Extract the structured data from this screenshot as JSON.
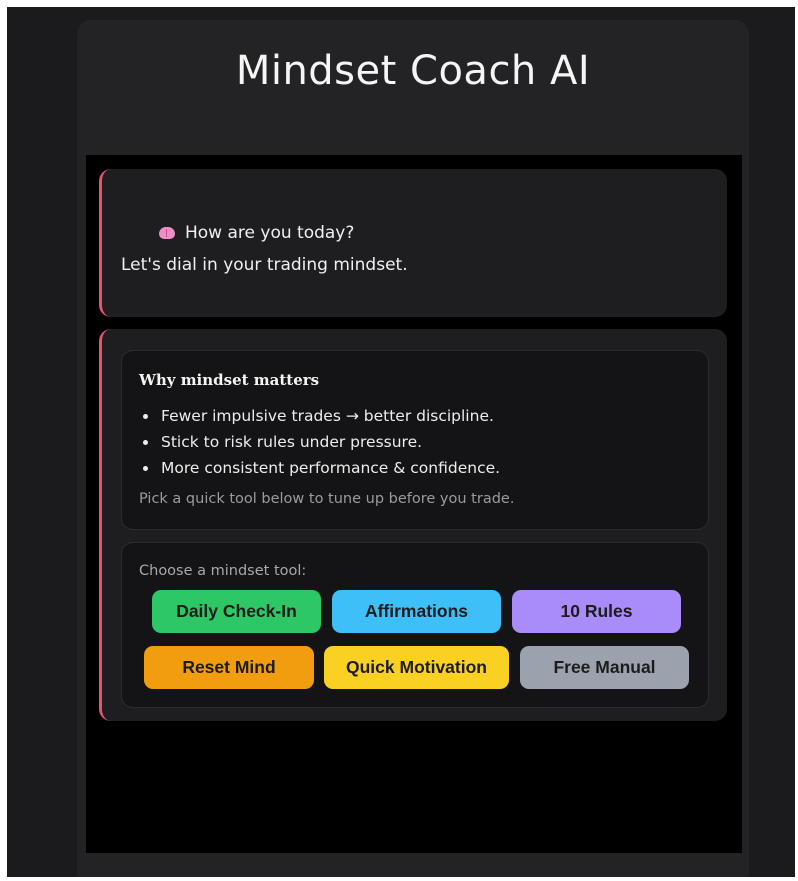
{
  "app": {
    "title": "Mindset Coach AI"
  },
  "messages": [
    {
      "icon": "brain-icon",
      "line1": "How are you today?",
      "line2": "Let's dial in your trading mindset."
    }
  ],
  "why_card": {
    "heading": "Why mindset matters",
    "bullets": [
      "Fewer impulsive trades → better discipline.",
      "Stick to risk rules under pressure.",
      "More consistent performance & confidence."
    ],
    "note": "Pick a quick tool below to tune up before you trade."
  },
  "tools_card": {
    "label": "Choose a mindset tool:",
    "buttons": [
      {
        "label": "Daily Check-In",
        "color": "#2ec766"
      },
      {
        "label": "Affirmations",
        "color": "#3ebff8"
      },
      {
        "label": "10 Rules",
        "color": "#a98bf9"
      },
      {
        "label": "Reset Mind",
        "color": "#f29d0e"
      },
      {
        "label": "Quick Motivation",
        "color": "#fad023"
      },
      {
        "label": "Free Manual",
        "color": "#9ba2ae"
      }
    ]
  },
  "colors": {
    "accent": "#e2566f",
    "background": "#000000",
    "panel": "#232326"
  }
}
